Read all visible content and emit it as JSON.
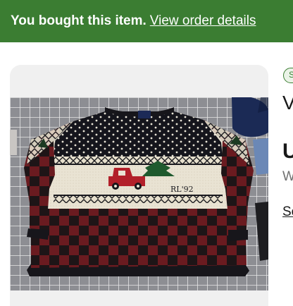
{
  "banner": {
    "message": "You bought this item.",
    "link_label": "View order details"
  },
  "listing": {
    "image_alt": "Red and black plaid knit sweater with a red truck carrying a Christmas tree",
    "sweater_knit_text": "RL'92",
    "badge_fragment": "S",
    "title_fragment": "V",
    "price_fragment": "U",
    "subtext_fragment": "W",
    "link_fragment": "Se"
  },
  "colors": {
    "banner_bg": "#3b7d32",
    "banner_text": "#ffffff",
    "card_bg": "#f0f0f0"
  }
}
